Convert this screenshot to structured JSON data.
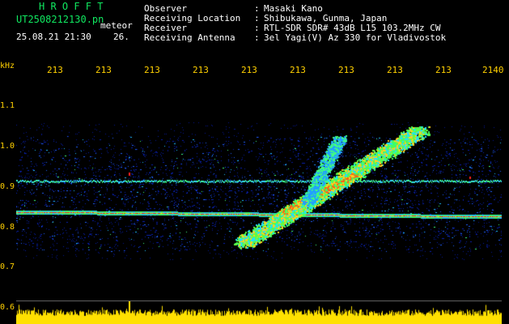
{
  "header": {
    "brand": "H R O F F T",
    "filename": "UT2508212130.pn",
    "event_type": "meteor",
    "datetime": "25.08.21 21:30",
    "seconds": "26.",
    "fields": [
      {
        "key": "Observer",
        "value": "Masaki Kano"
      },
      {
        "key": "Receiving Location",
        "value": "Shibukawa, Gunma, Japan"
      },
      {
        "key": "Receiver",
        "value": "RTL-SDR SDR# 43dB L15 103.2MHz CW"
      },
      {
        "key": "Receiving Antenna",
        "value": "3el Yagi(V) Az 330 for Vladivostok"
      }
    ],
    "separator": ":"
  },
  "axes": {
    "y_unit": "kHz",
    "y_ticks": [
      "1.1",
      "1.0",
      "0.9",
      "0.8",
      "0.7",
      "0.6"
    ],
    "x_ticks": [
      "213",
      "213",
      "213",
      "213",
      "213",
      "213",
      "213",
      "213",
      "213",
      "2140"
    ]
  },
  "colors": {
    "text_green": "#10e860",
    "text_yellow": "#ffd000",
    "background": "#000000",
    "noise_blue": "#1030c0",
    "carrier_red": "#ff3010",
    "floor_yellow": "#ffe000"
  },
  "signals": {
    "carrier_khz": 0.84,
    "second_line_khz": 0.92,
    "meteor_trace": "diagonal streak from ~0.77 to ~1.04 kHz"
  }
}
